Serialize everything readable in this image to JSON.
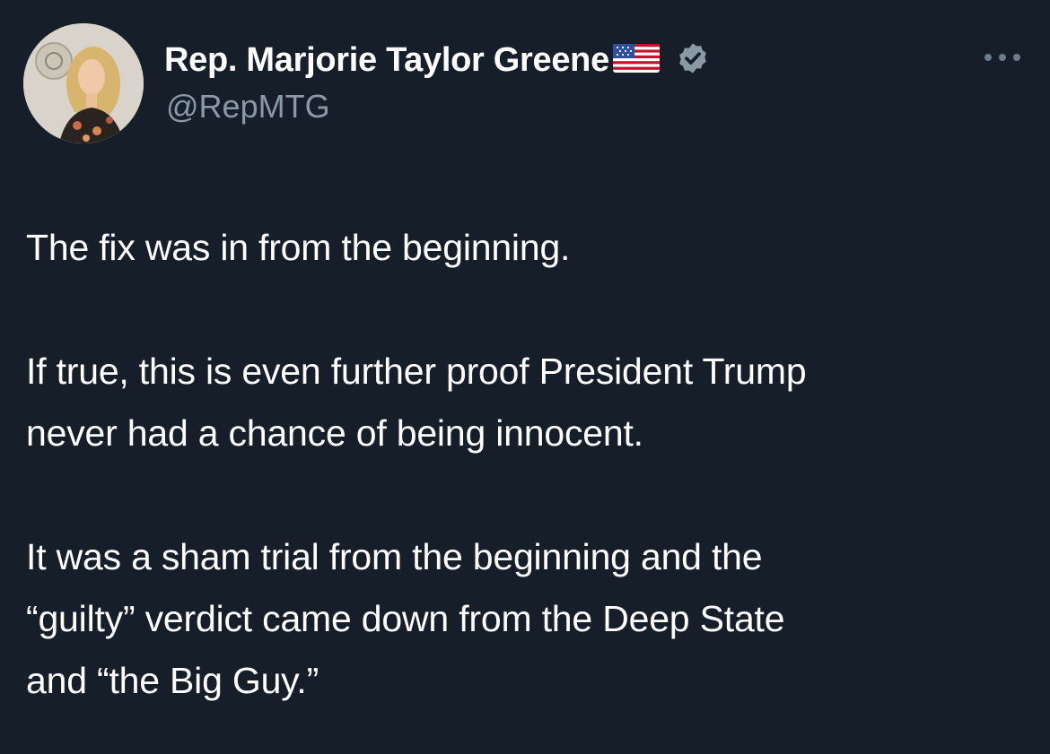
{
  "author": {
    "display_name": "Rep. Marjorie Taylor Greene",
    "handle": "@RepMTG",
    "flag_icon": "us-flag-icon",
    "verified_icon": "verified-badge-icon",
    "verified_color": "#8b98a5"
  },
  "menu": {
    "icon": "more-options-icon"
  },
  "tweet": {
    "paragraphs": [
      {
        "lines": [
          "The fix was in from the beginning."
        ]
      },
      {
        "lines": [
          "If true, this is even further proof President Trump",
          "never had a chance of being innocent."
        ]
      },
      {
        "lines": [
          "It was a sham trial from the beginning and the",
          "“guilty” verdict came down from the Deep State",
          "and “the Big Guy.”"
        ]
      }
    ]
  },
  "theme": {
    "background": "#161e2a",
    "text": "#ffffff",
    "secondary_text": "#8b98a5"
  }
}
